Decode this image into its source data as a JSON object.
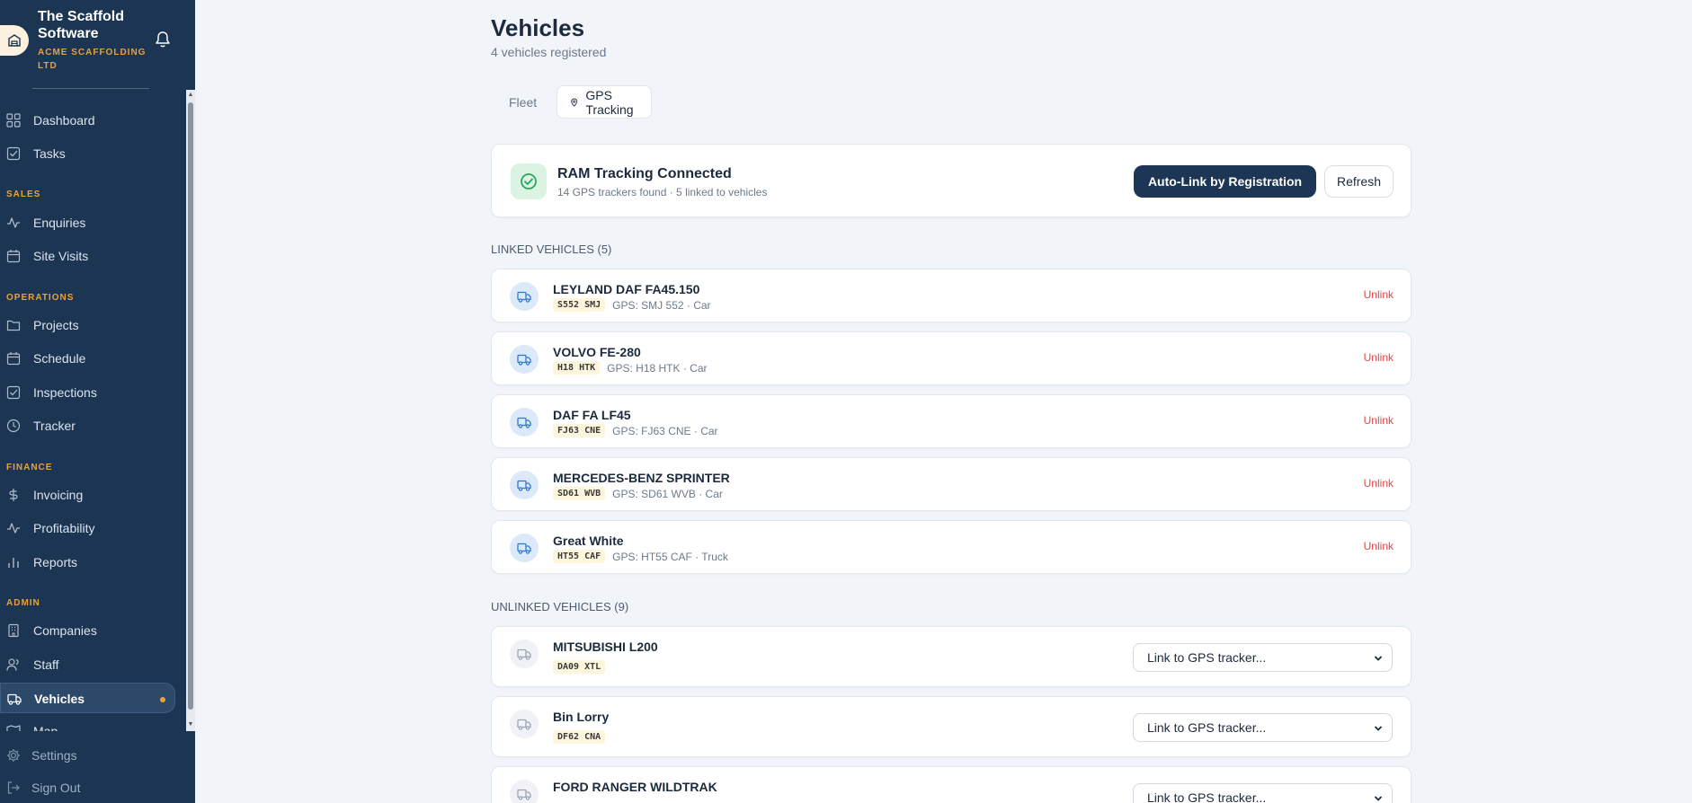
{
  "sidebar": {
    "brand_title": "The Scaffold Software",
    "brand_company": "ACME SCAFFOLDING LTD",
    "sections": {
      "sales": "SALES",
      "operations": "OPERATIONS",
      "finance": "FINANCE",
      "admin": "ADMIN"
    },
    "items": {
      "dashboard": "Dashboard",
      "tasks": "Tasks",
      "enquiries": "Enquiries",
      "site_visits": "Site Visits",
      "projects": "Projects",
      "schedule": "Schedule",
      "inspections": "Inspections",
      "tracker": "Tracker",
      "invoicing": "Invoicing",
      "profitability": "Profitability",
      "reports": "Reports",
      "companies": "Companies",
      "staff": "Staff",
      "vehicles": "Vehicles",
      "map": "Map"
    },
    "bottom": {
      "settings": "Settings",
      "sign_out": "Sign Out"
    },
    "active_item": "vehicles"
  },
  "header": {
    "title": "Vehicles",
    "subtitle": "4 vehicles registered"
  },
  "tabs": {
    "fleet": "Fleet",
    "gps": "GPS Tracking"
  },
  "status": {
    "title": "RAM Tracking Connected",
    "subtitle": "14 GPS trackers found · 5 linked to vehicles",
    "auto_link_label": "Auto-Link by Registration",
    "refresh_label": "Refresh",
    "accent": "#1d3656",
    "success_color": "#27a35a"
  },
  "linked": {
    "heading": "LINKED VEHICLES (5)",
    "action_label": "Unlink",
    "vehicles": [
      {
        "name": "LEYLAND DAF FA45.150",
        "plate": "S552 SMJ",
        "gps": "GPS: SMJ 552 · Car"
      },
      {
        "name": "VOLVO FE-280",
        "plate": "H18 HTK",
        "gps": "GPS: H18 HTK · Car"
      },
      {
        "name": "DAF FA LF45",
        "plate": "FJ63 CNE",
        "gps": "GPS: FJ63 CNE · Car"
      },
      {
        "name": "MERCEDES-BENZ SPRINTER",
        "plate": "SD61 WVB",
        "gps": "GPS: SD61 WVB · Car"
      },
      {
        "name": "Great White",
        "plate": "HT55 CAF",
        "gps": "GPS: HT55 CAF · Truck"
      }
    ]
  },
  "unlinked": {
    "heading": "UNLINKED VEHICLES (9)",
    "select_placeholder": "Link to GPS tracker...",
    "vehicles": [
      {
        "name": "MITSUBISHI L200",
        "plate": "DA09 XTL"
      },
      {
        "name": "Bin Lorry",
        "plate": "DF62 CNA"
      },
      {
        "name": "FORD RANGER WILDTRAK",
        "plate": ""
      }
    ]
  }
}
